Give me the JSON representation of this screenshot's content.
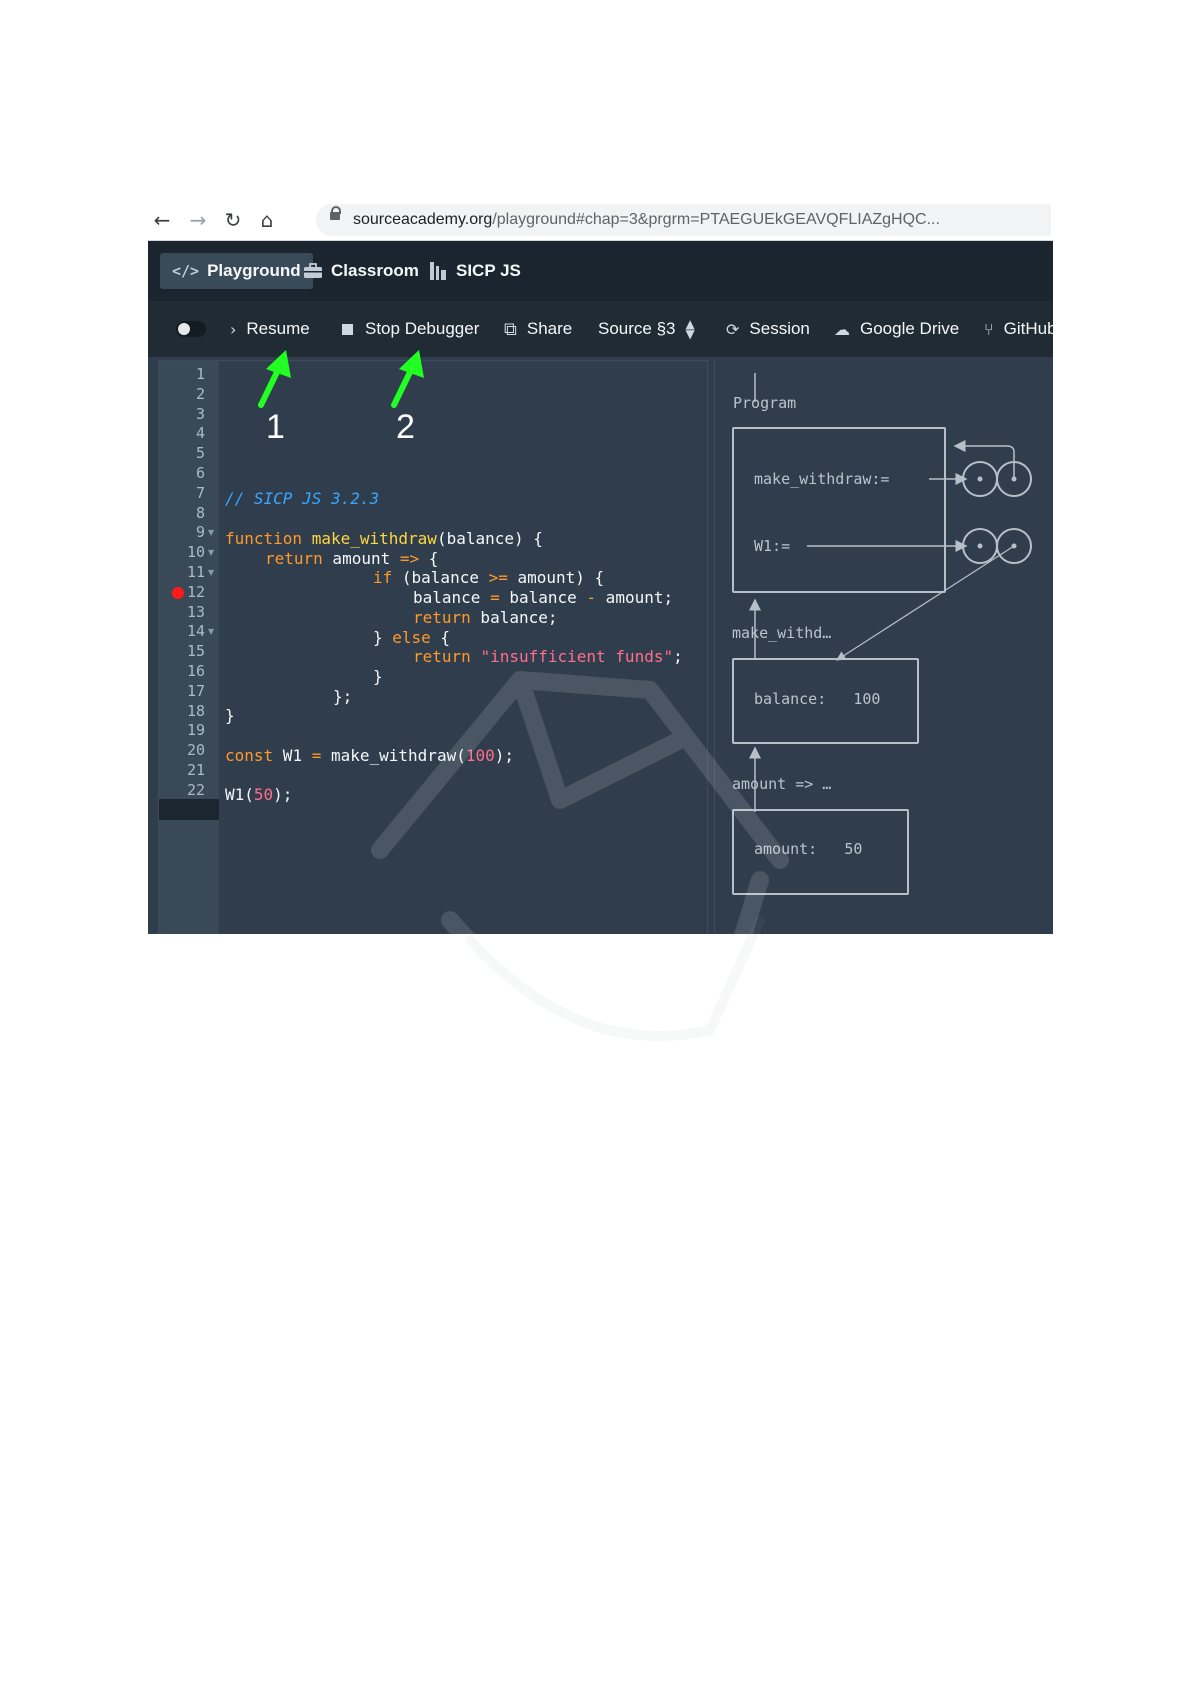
{
  "browser": {
    "url_host": "sourceacademy.org",
    "url_path": "/playground#chap=3&prgrm=PTAEGUEkGEAVQFLIAZgHQC..."
  },
  "appnav": {
    "tabs": [
      {
        "label": "Playground",
        "icon": "code-icon"
      },
      {
        "label": "Classroom",
        "icon": "briefcase-icon"
      },
      {
        "label": "SICP JS",
        "icon": "book-icon"
      }
    ]
  },
  "toolbar": {
    "resume": "Resume",
    "stop": "Stop Debugger",
    "share": "Share",
    "source": "Source §3",
    "session": "Session",
    "gdrive": "Google Drive",
    "github": "GitHub"
  },
  "annotations": {
    "one": "1",
    "two": "2",
    "arrow_color": "#22ff22"
  },
  "editor": {
    "line_numbers": [
      "1",
      "2",
      "3",
      "4",
      "5",
      "6",
      "7",
      "8",
      "9",
      "10",
      "11",
      "12",
      "13",
      "14",
      "15",
      "16",
      "17",
      "18",
      "19",
      "20",
      "21",
      "22"
    ],
    "breakpoint_line": "11",
    "code": {
      "l7_comment": "// SICP JS 3.2.3",
      "l9_kw": "function",
      "l9_fn": "make_withdraw",
      "l9_rest": "(balance) {",
      "l10_kw": "return",
      "l10_a": " amount ",
      "l10_op": "=>",
      "l10_b": " {",
      "l11_kw": "if",
      "l11_a": " (balance ",
      "l11_op": ">=",
      "l11_b": " amount) {",
      "l12_a": "balance ",
      "l12_op1": "=",
      "l12_b": " balance ",
      "l12_op2": "-",
      "l12_c": " amount;",
      "l13_kw": "return",
      "l13_a": " balance;",
      "l14_a": "} ",
      "l14_kw": "else",
      "l14_b": " {",
      "l15_kw": "return",
      "l15_str": "\"insufficient funds\"",
      "l15_b": ";",
      "l16": "}",
      "l17": "};",
      "l18": "}",
      "l20_kw": "const",
      "l20_a": " W1 ",
      "l20_op": "=",
      "l20_b": " make_withdraw(",
      "l20_num": "100",
      "l20_c": ");",
      "l22_a": "W1(",
      "l22_num": "50",
      "l22_b": ");"
    }
  },
  "env_diagram": {
    "program_label": "Program",
    "make_withdraw_binding": "make_withdraw:=",
    "w1_binding": "W1:=",
    "frame2_label": "make_withd…",
    "balance_binding": "balance:",
    "balance_value": "100",
    "frame3_label": "amount => …",
    "amount_binding": "amount:",
    "amount_value": "50"
  }
}
